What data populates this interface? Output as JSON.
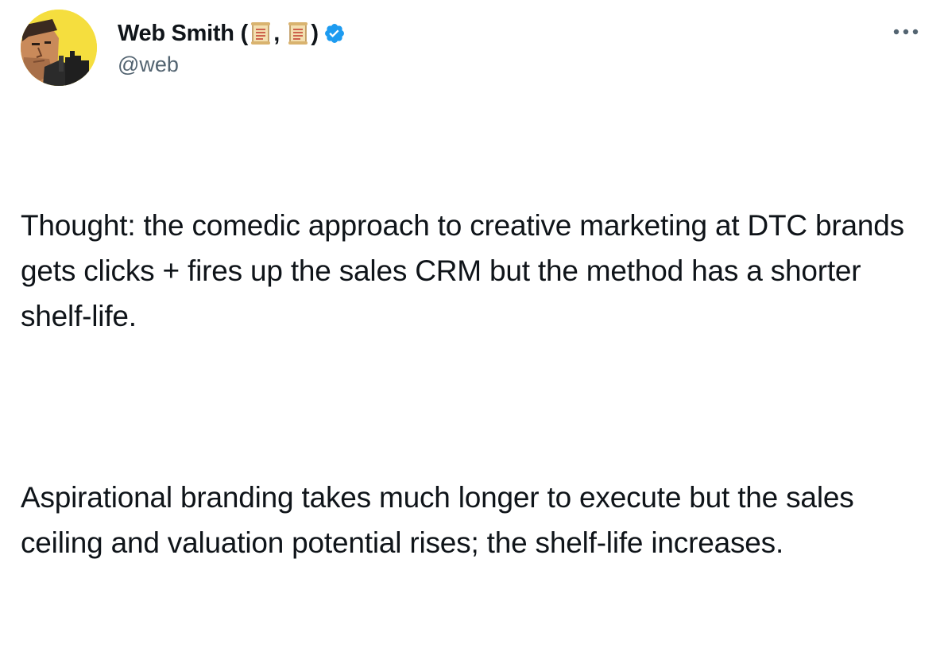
{
  "tweet": {
    "author": {
      "name": "Web Smith",
      "name_open_paren": "(",
      "name_separator": ",",
      "name_close_paren": ")",
      "name_emoji": [
        "scroll-icon",
        "scroll-icon"
      ],
      "handle": "@web",
      "verified": true,
      "verified_color": "#1d9bf0"
    },
    "more_label": "More",
    "paragraphs": [
      "Thought: the comedic approach to creative marketing at DTC brands gets clicks + fires up the sales CRM but the method has a shorter shelf-life.",
      "Aspirational branding takes much longer to execute but the sales ceiling and valuation potential rises; the shelf-life increases."
    ]
  },
  "colors": {
    "text": "#0f1419",
    "secondary": "#536471",
    "avatar_bg": "#f5de3e",
    "verified": "#1d9bf0"
  }
}
